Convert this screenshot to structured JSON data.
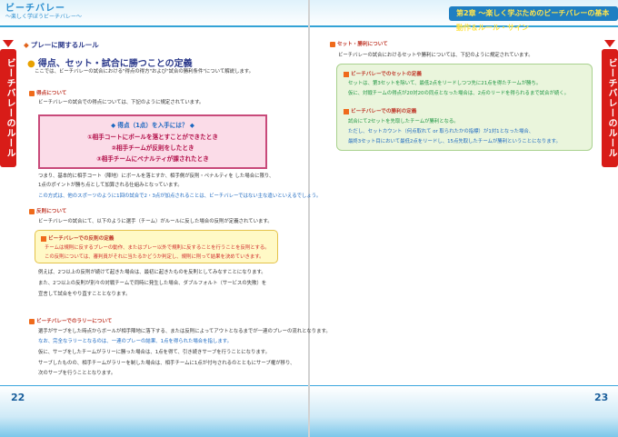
{
  "header": {
    "logo_line1": "ビーチバレー",
    "logo_line2": "〜楽しく学ぼうビーチバレー〜",
    "chapter_title": "第2章 ～楽しく学ぶためのビーチバレーの基本動作＆ルール・サイン"
  },
  "left_page": {
    "side_tab": "ビーチバレーのルール",
    "section": "プレーに関するルール",
    "heading": "得点、セット・試合に勝つことの定義",
    "intro": "ここでは、ビーチバレーの試合における\"得点の得方\"および\"試合の勝利条件\"について解説します。",
    "sub1": "得点について",
    "sub1_text": "ビーチバレーの試合での得点については、下記のように規定されています。",
    "pink_box": {
      "title": "◆ 得点（1点）を入手には？ ◆",
      "items": [
        "①相手コートにボールを落とすことができたとき",
        "②相手チームが反則をしたとき",
        "③相手チームにペナルティが課されたとき"
      ]
    },
    "para1": [
      "つまり、基本的に相手コート（陣地）にボールを落とすか、相手側が反則・ペナルティを した場合に限り、",
      "1点のポイントが勝ち点として加算される仕組みとなっています。"
    ],
    "para1_note": "この方式は、他のスポーツのように1回の試合で2・3点が加点されることは、ビーチバレーではない主な違いといえるでしょう。",
    "sub2": "反則について",
    "sub2_text": "ビーチバレーの試合にて、以下のように選手（チーム）がルールに反した場合の反則が定義されています。",
    "yellow_box": {
      "title": "ビーチバレーでの反則の定義",
      "lines": [
        "チームは規則に反するプレーの動作、またはプレー以外で規則に反することを行うことを反則とする。",
        "この反則については、審判員がそれに当たるかどうか判定し、規則に則って結果を決めていきます。"
      ]
    },
    "para2": [
      "例えば、2つ以上の反則が続けて起きた場合は、最初に起きたものを反則としてみなすことになります。",
      "また、2つ以上の反則が別々の対戦チームで同時に発生した場合、ダブルフォルト（サービスの失敗）を",
      "宣言して試合をやり直すこととなります。"
    ],
    "sub3": "ビーチバレーでのラリーについて",
    "para3": [
      "選手がサーブをした時点からボールが相手陣地に落下する、または反則によってアウトとなるまでが一連のプレーの流れとなります。",
      "なお、完全なラリーとなるのは、一連のプレーの結果、1点を得られた場合を指します。",
      "仮に、サーブをしたチームがラリーに勝った場合は、1点を得て、引き続きサーブを行うことになります。",
      "サーブしたものの、相手チームがラリーを制した場合は、相手チームに1点が付与されるのとともにサーブ権が移り、",
      "次のサーブを行うこととなります。"
    ],
    "page_number": "22"
  },
  "right_page": {
    "side_tab": "ビーチバレーのルール",
    "section": "セット・勝利について",
    "intro": "ビーチバレーの試合におけるセットや勝利については、下記のように規定されています。",
    "green_box": {
      "title1": "ビーチバレーでのセットの定義",
      "lines1": [
        "セットは、第3セットを除いて、最低2点をリードしつつ先に21点を得たチームが勝ち。",
        "仮に、対戦チームの得点が20対20の同点となった場合は、2点のリードを得られるまで試合が続く。"
      ],
      "title2": "ビーチバレーでの勝利の定義",
      "lines2": [
        "試合にて2セットを先取したチームが勝利となる。",
        "ただし、セットカウント（何点取れて or 取られたかの指標）が1対1となった場合、",
        "最終3セット目において最低2点をリードし、15点先取したチームが勝利ということになります。"
      ]
    },
    "page_number": "23"
  }
}
